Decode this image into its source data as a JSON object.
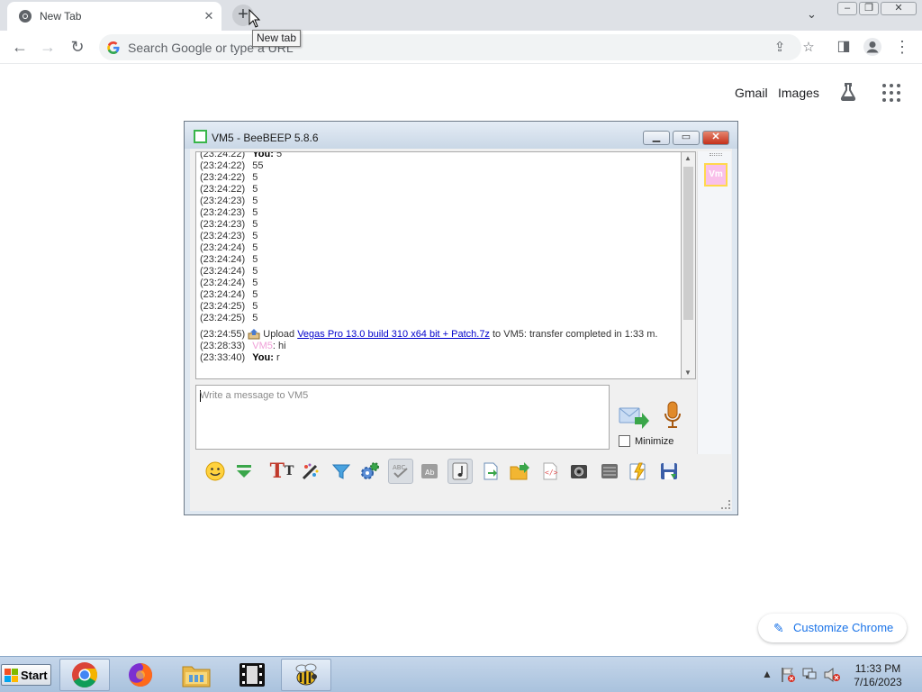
{
  "browser": {
    "tab_title": "New Tab",
    "new_tab_tooltip": "New tab",
    "omnibox_placeholder": "Search Google or type a URL"
  },
  "ntp": {
    "gmail": "Gmail",
    "images": "Images",
    "customize_label": "Customize Chrome"
  },
  "beebeep": {
    "title": "VM5 - BeeBEEP 5.8.6",
    "avatar_text": "Vm",
    "chat": [
      {
        "ts": "(23:24:22)",
        "who": "You:",
        "text": "5"
      },
      {
        "ts": "(23:24:22)",
        "text": "55"
      },
      {
        "ts": "(23:24:22)",
        "text": "5"
      },
      {
        "ts": "(23:24:22)",
        "text": "5"
      },
      {
        "ts": "(23:24:23)",
        "text": "5"
      },
      {
        "ts": "(23:24:23)",
        "text": "5"
      },
      {
        "ts": "(23:24:23)",
        "text": "5"
      },
      {
        "ts": "(23:24:23)",
        "text": "5"
      },
      {
        "ts": "(23:24:24)",
        "text": "5"
      },
      {
        "ts": "(23:24:24)",
        "text": "5"
      },
      {
        "ts": "(23:24:24)",
        "text": "5"
      },
      {
        "ts": "(23:24:24)",
        "text": "5"
      },
      {
        "ts": "(23:24:24)",
        "text": "5"
      },
      {
        "ts": "(23:24:25)",
        "text": "5"
      },
      {
        "ts": "(23:24:25)",
        "text": "5"
      }
    ],
    "upload": {
      "ts": "(23:24:55)",
      "prefix": "Upload",
      "file": "Vegas Pro 13.0 build 310 x64 bit + Patch.7z",
      "suffix": "to VM5: transfer completed in 1:33 m."
    },
    "msg_vm5": {
      "ts": "(23:28:33)",
      "who": "VM5",
      "text": ": hi"
    },
    "msg_you": {
      "ts": "(23:33:40)",
      "who": "You:",
      "text": "r"
    },
    "input_placeholder": "Write a message to VM5",
    "minimize_label": "Minimize"
  },
  "taskbar": {
    "start_label": "Start",
    "clock_time": "11:33 PM",
    "clock_date": "7/16/2023"
  },
  "colors": {
    "chrome_frame": "#dee1e6",
    "accent_blue": "#1a73e8",
    "vm5_name": "#f0a0d8",
    "taskbar": "#a9c2dd"
  }
}
